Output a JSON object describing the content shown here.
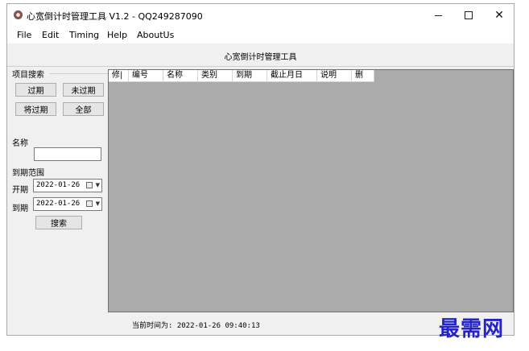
{
  "window": {
    "title": "心宽倒计时管理工具 V1.2 - QQ249287090",
    "minimize": "minimize",
    "maximize": "maximize",
    "close": "✕"
  },
  "menu": [
    "File",
    "Edit",
    "Timing",
    "Help",
    "AboutUs"
  ],
  "header": {
    "title": "心宽倒计时管理工具"
  },
  "search": {
    "group_label": "项目搜索",
    "buttons": {
      "expired": "过期",
      "not_expired": "未过期",
      "soon_expire": "将过期",
      "all": "全部"
    },
    "name_label": "名称",
    "name_value": "",
    "range_label": "到期范围",
    "start_label": "开期",
    "start_date": "2022-01-26",
    "end_label": "到期",
    "end_date": "2022-01-26",
    "search_button": "搜索"
  },
  "table": {
    "columns": [
      "修|",
      "编号",
      "名称",
      "类别",
      "到期",
      "截止月日",
      "说明",
      "删"
    ],
    "rows": []
  },
  "status": {
    "current_time": "当前时间为: 2022-01-26 09:40:13"
  },
  "watermark": "最需网",
  "icons": {
    "app": "app-icon",
    "calendar": "calendar-icon",
    "dropdown": "chevron-down-icon"
  }
}
